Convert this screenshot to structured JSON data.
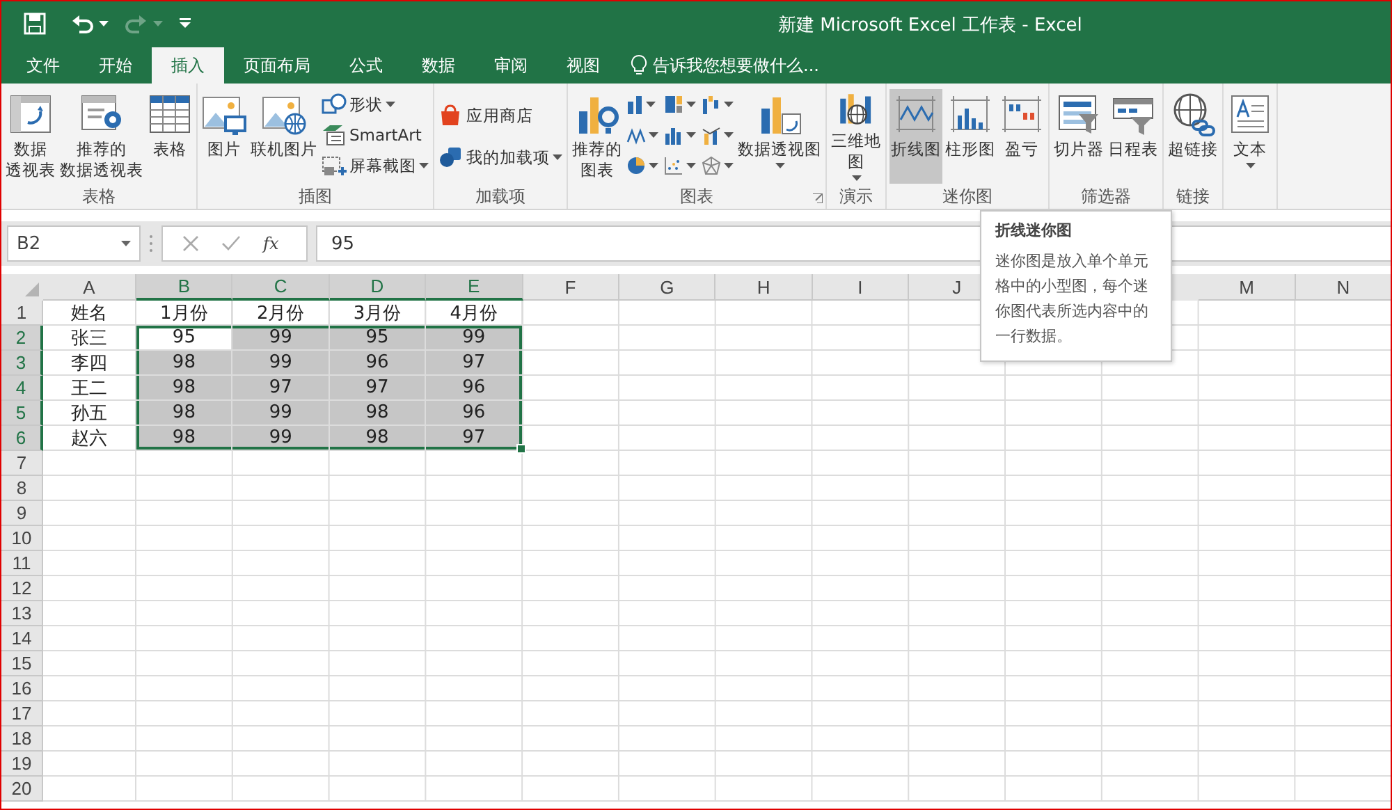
{
  "window": {
    "title": "新建 Microsoft Excel 工作表 - Excel"
  },
  "quick_access": [
    {
      "kind": "save",
      "disabled": false
    },
    {
      "kind": "undo",
      "disabled": false
    },
    {
      "kind": "redo",
      "disabled": true
    },
    {
      "kind": "customize",
      "disabled": false
    }
  ],
  "tabs": [
    {
      "label": "文件",
      "selected": false
    },
    {
      "label": "开始",
      "selected": false
    },
    {
      "label": "插入",
      "selected": true
    },
    {
      "label": "页面布局",
      "selected": false
    },
    {
      "label": "公式",
      "selected": false
    },
    {
      "label": "数据",
      "selected": false
    },
    {
      "label": "审阅",
      "selected": false
    },
    {
      "label": "视图",
      "selected": false
    }
  ],
  "tell_me": {
    "placeholder": "告诉我您想要做什么..."
  },
  "ribbon": {
    "groups": [
      {
        "label": "表格",
        "buttons": [
          {
            "kind": "large",
            "label": [
              "数据",
              "透视表"
            ],
            "dropdown": false,
            "selected": false
          },
          {
            "kind": "large",
            "label": [
              "推荐的",
              "数据透视表"
            ],
            "dropdown": false,
            "selected": false
          },
          {
            "kind": "large",
            "label": "表格",
            "dropdown": false,
            "selected": false
          }
        ]
      },
      {
        "label": "插图",
        "buttons": [
          {
            "kind": "large",
            "label": "图片",
            "dropdown": false,
            "selected": false
          },
          {
            "kind": "large",
            "label": "联机图片",
            "dropdown": false,
            "selected": false
          },
          {
            "kind": "small",
            "label": "形状",
            "dropdown": true,
            "selected": false
          },
          {
            "kind": "small",
            "label": "SmartArt",
            "dropdown": false,
            "selected": false
          },
          {
            "kind": "small",
            "label": "屏幕截图",
            "dropdown": true,
            "selected": false
          }
        ]
      },
      {
        "label": "加载项",
        "buttons": [
          {
            "kind": "medium",
            "label": "应用商店",
            "dropdown": false,
            "selected": false
          },
          {
            "kind": "medium",
            "label": "我的加载项",
            "dropdown": true,
            "selected": false
          }
        ]
      },
      {
        "label": "图表",
        "launcher": true,
        "buttons": [
          {
            "kind": "large",
            "label": [
              "推荐的",
              "图表"
            ],
            "dropdown": false,
            "selected": false
          },
          {
            "kind": "icon",
            "dropdown": true,
            "selected": false
          },
          {
            "kind": "icon",
            "dropdown": true,
            "selected": false
          },
          {
            "kind": "icon",
            "dropdown": true,
            "selected": false
          },
          {
            "kind": "icon",
            "dropdown": true,
            "selected": false
          },
          {
            "kind": "icon",
            "dropdown": true,
            "selected": false
          },
          {
            "kind": "icon",
            "dropdown": true,
            "selected": false
          },
          {
            "kind": "icon",
            "dropdown": true,
            "selected": false
          },
          {
            "kind": "icon",
            "dropdown": true,
            "selected": false
          },
          {
            "kind": "icon",
            "dropdown": true,
            "selected": false
          },
          {
            "kind": "large",
            "label": "数据透视图",
            "dropdown": true,
            "selected": false
          }
        ]
      },
      {
        "label": "演示",
        "buttons": [
          {
            "kind": "large",
            "label": [
              "三维地",
              "图"
            ],
            "dropdown": true,
            "selected": false
          }
        ]
      },
      {
        "label": "迷你图",
        "buttons": [
          {
            "kind": "large",
            "label": "折线图",
            "dropdown": false,
            "selected": true
          },
          {
            "kind": "large",
            "label": "柱形图",
            "dropdown": false,
            "selected": false
          },
          {
            "kind": "large",
            "label": "盈亏",
            "dropdown": false,
            "selected": false
          }
        ]
      },
      {
        "label": "筛选器",
        "buttons": [
          {
            "kind": "large",
            "label": "切片器",
            "dropdown": false,
            "selected": false
          },
          {
            "kind": "large",
            "label": "日程表",
            "dropdown": false,
            "selected": false
          }
        ]
      },
      {
        "label": "链接",
        "buttons": [
          {
            "kind": "large",
            "label": "超链接",
            "dropdown": false,
            "selected": false
          }
        ]
      },
      {
        "buttons": [
          {
            "kind": "large",
            "label": "文本",
            "dropdown": true,
            "selected": false
          }
        ]
      }
    ]
  },
  "formula_bar": {
    "name_box": "B2",
    "function_label": "fx",
    "value": "95"
  },
  "sheet": {
    "columns": [
      {
        "label": "A",
        "selected": false
      },
      {
        "label": "B",
        "selected": true
      },
      {
        "label": "C",
        "selected": true
      },
      {
        "label": "D",
        "selected": true
      },
      {
        "label": "E",
        "selected": true
      },
      {
        "label": "F",
        "selected": false
      },
      {
        "label": "G",
        "selected": false
      },
      {
        "label": "H",
        "selected": false
      },
      {
        "label": "I",
        "selected": false
      },
      {
        "label": "J",
        "selected": false
      },
      {},
      {},
      {
        "label": "M",
        "selected": false
      },
      {
        "label": "N",
        "selected": false
      }
    ],
    "rows": [
      {
        "header": "1",
        "selected": false,
        "cells": [
          {
            "text": "姓名",
            "selected": false
          },
          {
            "text": "1月份",
            "selected": false
          },
          {
            "text": "2月份",
            "selected": false
          },
          {
            "text": "3月份",
            "selected": false
          },
          {
            "text": "4月份",
            "selected": false
          }
        ]
      },
      {
        "header": "2",
        "selected": true,
        "cells": [
          {
            "text": "张三",
            "selected": false
          },
          {
            "text": "95",
            "selected": true,
            "active": true
          },
          {
            "text": "99",
            "selected": true
          },
          {
            "text": "95",
            "selected": true
          },
          {
            "text": "99",
            "selected": true
          }
        ]
      },
      {
        "header": "3",
        "selected": true,
        "cells": [
          {
            "text": "李四",
            "selected": false
          },
          {
            "text": "98",
            "selected": true
          },
          {
            "text": "99",
            "selected": true
          },
          {
            "text": "96",
            "selected": true
          },
          {
            "text": "97",
            "selected": true
          }
        ]
      },
      {
        "header": "4",
        "selected": true,
        "cells": [
          {
            "text": "王二",
            "selected": false
          },
          {
            "text": "98",
            "selected": true
          },
          {
            "text": "97",
            "selected": true
          },
          {
            "text": "97",
            "selected": true
          },
          {
            "text": "96",
            "selected": true
          }
        ]
      },
      {
        "header": "5",
        "selected": true,
        "cells": [
          {
            "text": "孙五",
            "selected": false
          },
          {
            "text": "98",
            "selected": true
          },
          {
            "text": "99",
            "selected": true
          },
          {
            "text": "98",
            "selected": true
          },
          {
            "text": "96",
            "selected": true
          }
        ]
      },
      {
        "header": "6",
        "selected": true,
        "cells": [
          {
            "text": "赵六",
            "selected": false
          },
          {
            "text": "98",
            "selected": true
          },
          {
            "text": "99",
            "selected": true
          },
          {
            "text": "98",
            "selected": true
          },
          {
            "text": "97",
            "selected": true
          }
        ]
      },
      {
        "header": "7",
        "selected": false
      },
      {
        "header": "8",
        "selected": false
      },
      {
        "header": "9",
        "selected": false
      },
      {
        "header": "10",
        "selected": false
      },
      {
        "header": "11",
        "selected": false
      },
      {
        "header": "12",
        "selected": false
      },
      {
        "header": "13",
        "selected": false
      },
      {
        "header": "14",
        "selected": false
      },
      {
        "header": "15",
        "selected": false
      },
      {
        "header": "16",
        "selected": false
      },
      {
        "header": "17",
        "selected": false
      },
      {
        "header": "18",
        "selected": false
      },
      {
        "header": "19",
        "selected": false
      },
      {
        "header": "20",
        "selected": false
      }
    ]
  },
  "tooltip": {
    "title": "折线迷你图",
    "body": "迷你图是放入单个单元格中的小型图，每个迷你图代表所选内容中的一行数据。"
  }
}
